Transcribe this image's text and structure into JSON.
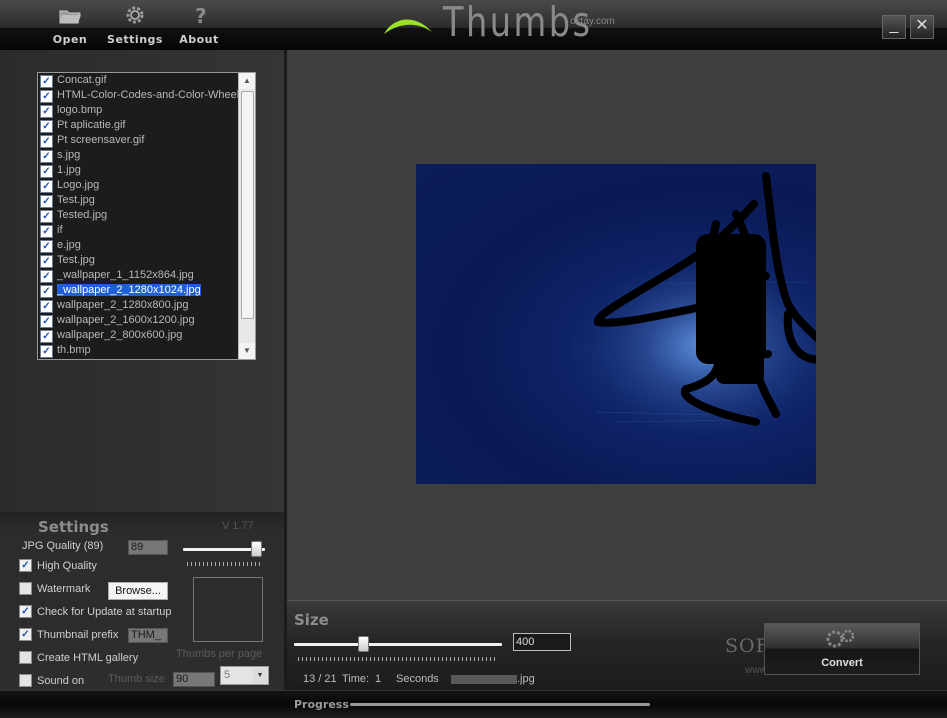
{
  "toolbar": {
    "open_label": "Open",
    "settings_label": "Settings",
    "about_label": "About"
  },
  "app": {
    "title": "Thumbs",
    "site": "oktay.com",
    "minimize_label": "_",
    "close_label": "✕"
  },
  "files": [
    {
      "name": "Concat.gif",
      "checked": true,
      "selected": false
    },
    {
      "name": "HTML-Color-Codes-and-Color-Wheel.gif",
      "checked": true,
      "selected": false
    },
    {
      "name": "logo.bmp",
      "checked": true,
      "selected": false
    },
    {
      "name": "Pt aplicatie.gif",
      "checked": true,
      "selected": false
    },
    {
      "name": "Pt screensaver.gif",
      "checked": true,
      "selected": false
    },
    {
      "name": "s.jpg",
      "checked": true,
      "selected": false
    },
    {
      "name": "1.jpg",
      "checked": true,
      "selected": false
    },
    {
      "name": "Logo.jpg",
      "checked": true,
      "selected": false
    },
    {
      "name": "Test.jpg",
      "checked": true,
      "selected": false
    },
    {
      "name": "Tested.jpg",
      "checked": true,
      "selected": false
    },
    {
      "name": "if",
      "checked": true,
      "selected": false
    },
    {
      "name": "e.jpg",
      "checked": true,
      "selected": false
    },
    {
      "name": "Test.jpg",
      "checked": true,
      "selected": false
    },
    {
      "name": "_wallpaper_1_1152x864.jpg",
      "checked": true,
      "selected": false
    },
    {
      "name": "_wallpaper_2_1280x1024.jpg",
      "checked": true,
      "selected": true
    },
    {
      "name": "wallpaper_2_1280x800.jpg",
      "checked": true,
      "selected": false
    },
    {
      "name": "wallpaper_2_1600x1200.jpg",
      "checked": true,
      "selected": false
    },
    {
      "name": "wallpaper_2_800x600.jpg",
      "checked": true,
      "selected": false
    },
    {
      "name": "th.bmp",
      "checked": true,
      "selected": false
    }
  ],
  "settings": {
    "title": "Settings",
    "version": "V 1.77",
    "jpg_quality_label": "JPG Quality (89)",
    "jpg_quality_value": "89",
    "jpg_quality_level": 0.89,
    "high_quality_label": "High Quality",
    "high_quality_checked": true,
    "watermark_label": "Watermark",
    "watermark_checked": false,
    "browse_label": "Browse...",
    "check_update_label": "Check for Update at startup",
    "check_update_checked": true,
    "thumb_prefix_label": "Thumbnail prefix",
    "thumb_prefix_checked": true,
    "thumb_prefix_value": "THM_",
    "create_gallery_label": "Create HTML gallery",
    "create_gallery_checked": false,
    "sound_label": "Sound on",
    "sound_checked": false,
    "thumbs_per_page_label": "Thumbs per page",
    "thumbs_per_page_value": "5",
    "thumb_size_label": "Thumb size",
    "thumb_size_value": "90"
  },
  "size": {
    "title": "Size",
    "value": "400",
    "slider_level": 0.33
  },
  "status": {
    "counter": "13 / 21",
    "time_label": "Time:",
    "time_value": "1",
    "seconds_label": "Seconds",
    "current_file": ".jpg"
  },
  "watermark_text": {
    "brand": "SOFTPEDIA",
    "url": "www.softpedia.com"
  },
  "convert_label": "Convert",
  "progress": {
    "label": "Progress",
    "value": 0
  },
  "colors": {
    "selection": "#1f5fd8",
    "accent_green": "#9be02a",
    "preview_bg": "#0a1a55"
  }
}
